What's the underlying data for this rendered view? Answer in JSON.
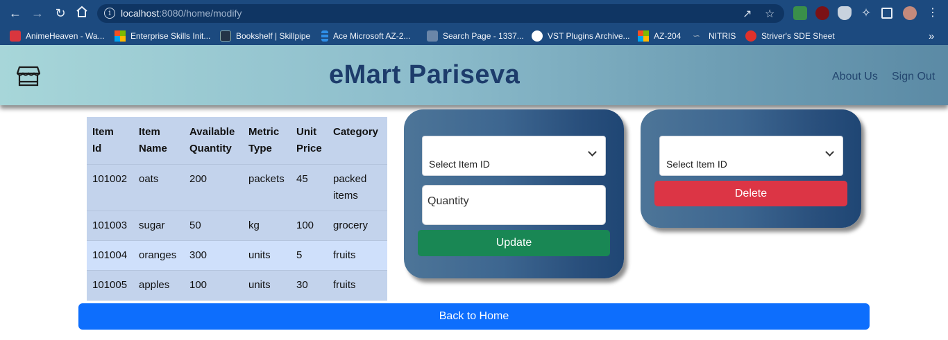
{
  "browser": {
    "url_host": "localhost",
    "url_rest": ":8080/home/modify",
    "bookmarks": [
      {
        "label": "AnimeHeaven - Wa...",
        "icon": "animeheaven-icon",
        "color": "#d9363e"
      },
      {
        "label": "Enterprise Skills Init...",
        "icon": "microsoft-icon",
        "color": ""
      },
      {
        "label": "Bookshelf | Skillpipe",
        "icon": "skillpipe-icon",
        "color": "#243447"
      },
      {
        "label": "Ace Microsoft AZ-2...",
        "icon": "stack-icon",
        "color": "#2f8fe8"
      },
      {
        "label": "Search Page - 1337...",
        "icon": "torrent-icon",
        "color": "#6b86a8"
      },
      {
        "label": "VST Plugins Archive...",
        "icon": "globe-icon",
        "color": "#ffffff"
      },
      {
        "label": "AZ-204",
        "icon": "microsoft-icon",
        "color": ""
      },
      {
        "label": "NITRIS",
        "icon": "nitris-icon",
        "color": "#9ab"
      },
      {
        "label": "Striver's SDE Sheet",
        "icon": "tuf-icon",
        "color": "#e0312b"
      }
    ],
    "more": "»"
  },
  "header": {
    "brand": "eMart Pariseva",
    "links": [
      "About Us",
      "Sign Out"
    ]
  },
  "table": {
    "columns": [
      [
        "Item",
        "Id"
      ],
      [
        "Item",
        "Name"
      ],
      [
        "Available",
        "Quantity"
      ],
      [
        "Metric",
        "Type"
      ],
      [
        "Unit",
        "Price"
      ],
      [
        "Category",
        ""
      ]
    ],
    "rows": [
      [
        "101002",
        "oats",
        "200",
        "packets",
        "45",
        "packed items"
      ],
      [
        "101003",
        "sugar",
        "50",
        "kg",
        "100",
        "grocery"
      ],
      [
        "101004",
        "oranges",
        "300",
        "units",
        "5",
        "fruits"
      ],
      [
        "101005",
        "apples",
        "100",
        "units",
        "30",
        "fruits"
      ]
    ]
  },
  "update_panel": {
    "select_label": "Select Item ID",
    "quantity_placeholder": "Quantity",
    "button": "Update"
  },
  "delete_panel": {
    "select_label": "Select Item ID",
    "button": "Delete"
  },
  "back_button": "Back to Home",
  "colors": {
    "update": "#198754",
    "delete": "#dc3545",
    "primary": "#0d6efd",
    "brand": "#1d3c6b"
  }
}
